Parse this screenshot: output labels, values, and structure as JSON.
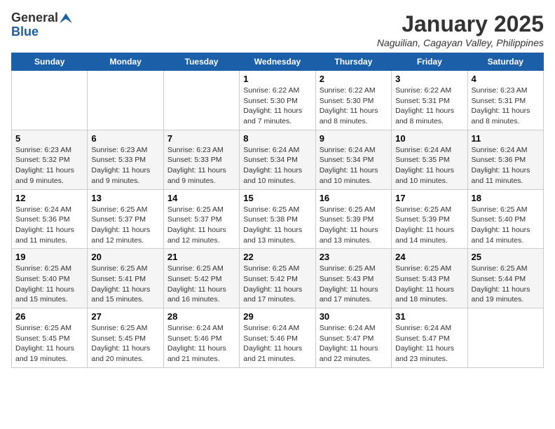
{
  "header": {
    "logo_general": "General",
    "logo_blue": "Blue",
    "title": "January 2025",
    "subtitle": "Naguilian, Cagayan Valley, Philippines"
  },
  "weekdays": [
    "Sunday",
    "Monday",
    "Tuesday",
    "Wednesday",
    "Thursday",
    "Friday",
    "Saturday"
  ],
  "weeks": [
    [
      {
        "day": "",
        "info": ""
      },
      {
        "day": "",
        "info": ""
      },
      {
        "day": "",
        "info": ""
      },
      {
        "day": "1",
        "info": "Sunrise: 6:22 AM\nSunset: 5:30 PM\nDaylight: 11 hours\nand 7 minutes."
      },
      {
        "day": "2",
        "info": "Sunrise: 6:22 AM\nSunset: 5:30 PM\nDaylight: 11 hours\nand 8 minutes."
      },
      {
        "day": "3",
        "info": "Sunrise: 6:22 AM\nSunset: 5:31 PM\nDaylight: 11 hours\nand 8 minutes."
      },
      {
        "day": "4",
        "info": "Sunrise: 6:23 AM\nSunset: 5:31 PM\nDaylight: 11 hours\nand 8 minutes."
      }
    ],
    [
      {
        "day": "5",
        "info": "Sunrise: 6:23 AM\nSunset: 5:32 PM\nDaylight: 11 hours\nand 9 minutes."
      },
      {
        "day": "6",
        "info": "Sunrise: 6:23 AM\nSunset: 5:33 PM\nDaylight: 11 hours\nand 9 minutes."
      },
      {
        "day": "7",
        "info": "Sunrise: 6:23 AM\nSunset: 5:33 PM\nDaylight: 11 hours\nand 9 minutes."
      },
      {
        "day": "8",
        "info": "Sunrise: 6:24 AM\nSunset: 5:34 PM\nDaylight: 11 hours\nand 10 minutes."
      },
      {
        "day": "9",
        "info": "Sunrise: 6:24 AM\nSunset: 5:34 PM\nDaylight: 11 hours\nand 10 minutes."
      },
      {
        "day": "10",
        "info": "Sunrise: 6:24 AM\nSunset: 5:35 PM\nDaylight: 11 hours\nand 10 minutes."
      },
      {
        "day": "11",
        "info": "Sunrise: 6:24 AM\nSunset: 5:36 PM\nDaylight: 11 hours\nand 11 minutes."
      }
    ],
    [
      {
        "day": "12",
        "info": "Sunrise: 6:24 AM\nSunset: 5:36 PM\nDaylight: 11 hours\nand 11 minutes."
      },
      {
        "day": "13",
        "info": "Sunrise: 6:25 AM\nSunset: 5:37 PM\nDaylight: 11 hours\nand 12 minutes."
      },
      {
        "day": "14",
        "info": "Sunrise: 6:25 AM\nSunset: 5:37 PM\nDaylight: 11 hours\nand 12 minutes."
      },
      {
        "day": "15",
        "info": "Sunrise: 6:25 AM\nSunset: 5:38 PM\nDaylight: 11 hours\nand 13 minutes."
      },
      {
        "day": "16",
        "info": "Sunrise: 6:25 AM\nSunset: 5:39 PM\nDaylight: 11 hours\nand 13 minutes."
      },
      {
        "day": "17",
        "info": "Sunrise: 6:25 AM\nSunset: 5:39 PM\nDaylight: 11 hours\nand 14 minutes."
      },
      {
        "day": "18",
        "info": "Sunrise: 6:25 AM\nSunset: 5:40 PM\nDaylight: 11 hours\nand 14 minutes."
      }
    ],
    [
      {
        "day": "19",
        "info": "Sunrise: 6:25 AM\nSunset: 5:40 PM\nDaylight: 11 hours\nand 15 minutes."
      },
      {
        "day": "20",
        "info": "Sunrise: 6:25 AM\nSunset: 5:41 PM\nDaylight: 11 hours\nand 15 minutes."
      },
      {
        "day": "21",
        "info": "Sunrise: 6:25 AM\nSunset: 5:42 PM\nDaylight: 11 hours\nand 16 minutes."
      },
      {
        "day": "22",
        "info": "Sunrise: 6:25 AM\nSunset: 5:42 PM\nDaylight: 11 hours\nand 17 minutes."
      },
      {
        "day": "23",
        "info": "Sunrise: 6:25 AM\nSunset: 5:43 PM\nDaylight: 11 hours\nand 17 minutes."
      },
      {
        "day": "24",
        "info": "Sunrise: 6:25 AM\nSunset: 5:43 PM\nDaylight: 11 hours\nand 18 minutes."
      },
      {
        "day": "25",
        "info": "Sunrise: 6:25 AM\nSunset: 5:44 PM\nDaylight: 11 hours\nand 19 minutes."
      }
    ],
    [
      {
        "day": "26",
        "info": "Sunrise: 6:25 AM\nSunset: 5:45 PM\nDaylight: 11 hours\nand 19 minutes."
      },
      {
        "day": "27",
        "info": "Sunrise: 6:25 AM\nSunset: 5:45 PM\nDaylight: 11 hours\nand 20 minutes."
      },
      {
        "day": "28",
        "info": "Sunrise: 6:24 AM\nSunset: 5:46 PM\nDaylight: 11 hours\nand 21 minutes."
      },
      {
        "day": "29",
        "info": "Sunrise: 6:24 AM\nSunset: 5:46 PM\nDaylight: 11 hours\nand 21 minutes."
      },
      {
        "day": "30",
        "info": "Sunrise: 6:24 AM\nSunset: 5:47 PM\nDaylight: 11 hours\nand 22 minutes."
      },
      {
        "day": "31",
        "info": "Sunrise: 6:24 AM\nSunset: 5:47 PM\nDaylight: 11 hours\nand 23 minutes."
      },
      {
        "day": "",
        "info": ""
      }
    ]
  ]
}
